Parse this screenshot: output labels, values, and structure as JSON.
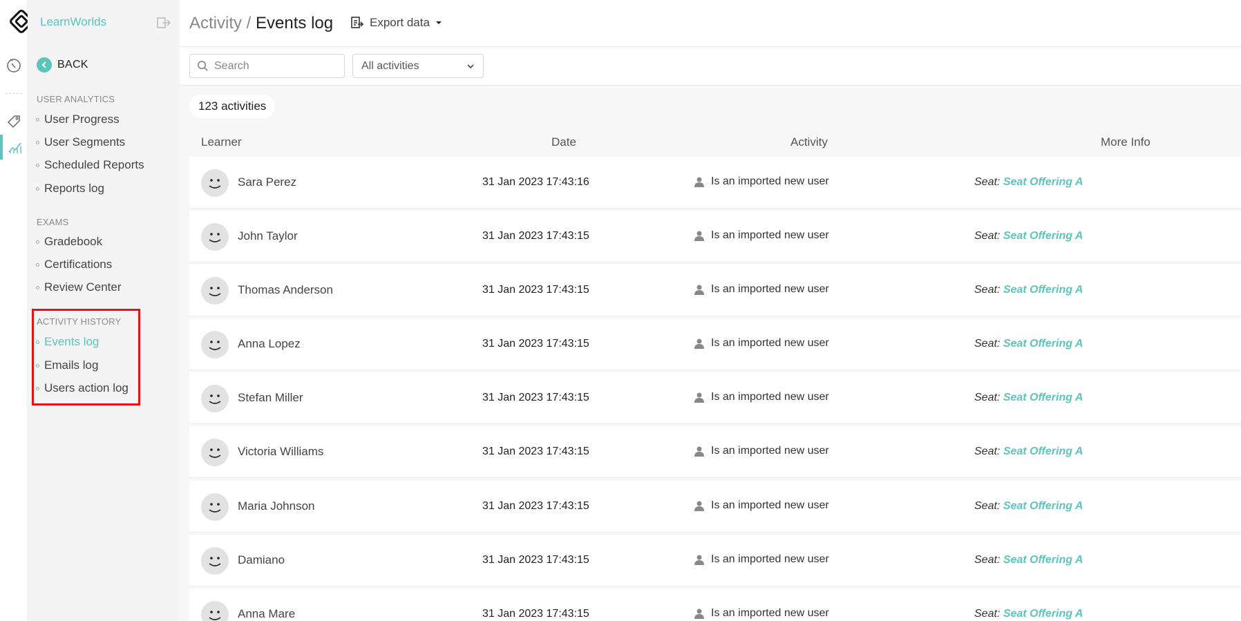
{
  "brand": {
    "name": "LearnWorlds"
  },
  "sidebar": {
    "back_label": "BACK",
    "sections": [
      {
        "title": "USER ANALYTICS",
        "items": [
          "User Progress",
          "User Segments",
          "Scheduled Reports",
          "Reports log"
        ]
      },
      {
        "title": "EXAMS",
        "items": [
          "Gradebook",
          "Certifications",
          "Review Center"
        ]
      },
      {
        "title": "ACTIVITY HISTORY",
        "items": [
          "Events log",
          "Emails log",
          "Users action log"
        ]
      }
    ],
    "active_item": "Events log",
    "accent_color": "#5bc4bd"
  },
  "header": {
    "breadcrumb_parent": "Activity",
    "breadcrumb_sep": " / ",
    "breadcrumb_current": "Events log",
    "export_label": "Export data"
  },
  "filters": {
    "search_placeholder": "Search",
    "activity_filter": "All activities"
  },
  "count_label": "123 activities",
  "table": {
    "columns": [
      "Learner",
      "Date",
      "Activity",
      "More Info"
    ],
    "rows": [
      {
        "learner": "Sara Perez",
        "date": "31 Jan 2023 17:43:16",
        "activity": "Is an imported new user",
        "seat_label": "Seat:",
        "seat_value": "Seat Offering A"
      },
      {
        "learner": "John Taylor",
        "date": "31 Jan 2023 17:43:15",
        "activity": "Is an imported new user",
        "seat_label": "Seat:",
        "seat_value": "Seat Offering A"
      },
      {
        "learner": "Thomas Anderson",
        "date": "31 Jan 2023 17:43:15",
        "activity": "Is an imported new user",
        "seat_label": "Seat:",
        "seat_value": "Seat Offering A"
      },
      {
        "learner": "Anna Lopez",
        "date": "31 Jan 2023 17:43:15",
        "activity": "Is an imported new user",
        "seat_label": "Seat:",
        "seat_value": "Seat Offering A"
      },
      {
        "learner": "Stefan Miller",
        "date": "31 Jan 2023 17:43:15",
        "activity": "Is an imported new user",
        "seat_label": "Seat:",
        "seat_value": "Seat Offering A"
      },
      {
        "learner": "Victoria Williams",
        "date": "31 Jan 2023 17:43:15",
        "activity": "Is an imported new user",
        "seat_label": "Seat:",
        "seat_value": "Seat Offering A"
      },
      {
        "learner": "Maria Johnson",
        "date": "31 Jan 2023 17:43:15",
        "activity": "Is an imported new user",
        "seat_label": "Seat:",
        "seat_value": "Seat Offering A"
      },
      {
        "learner": "Damiano",
        "date": "31 Jan 2023 17:43:15",
        "activity": "Is an imported new user",
        "seat_label": "Seat:",
        "seat_value": "Seat Offering A"
      },
      {
        "learner": "Anna Mare",
        "date": "31 Jan 2023 17:43:15",
        "activity": "Is an imported new user",
        "seat_label": "Seat:",
        "seat_value": "Seat Offering A"
      }
    ]
  }
}
